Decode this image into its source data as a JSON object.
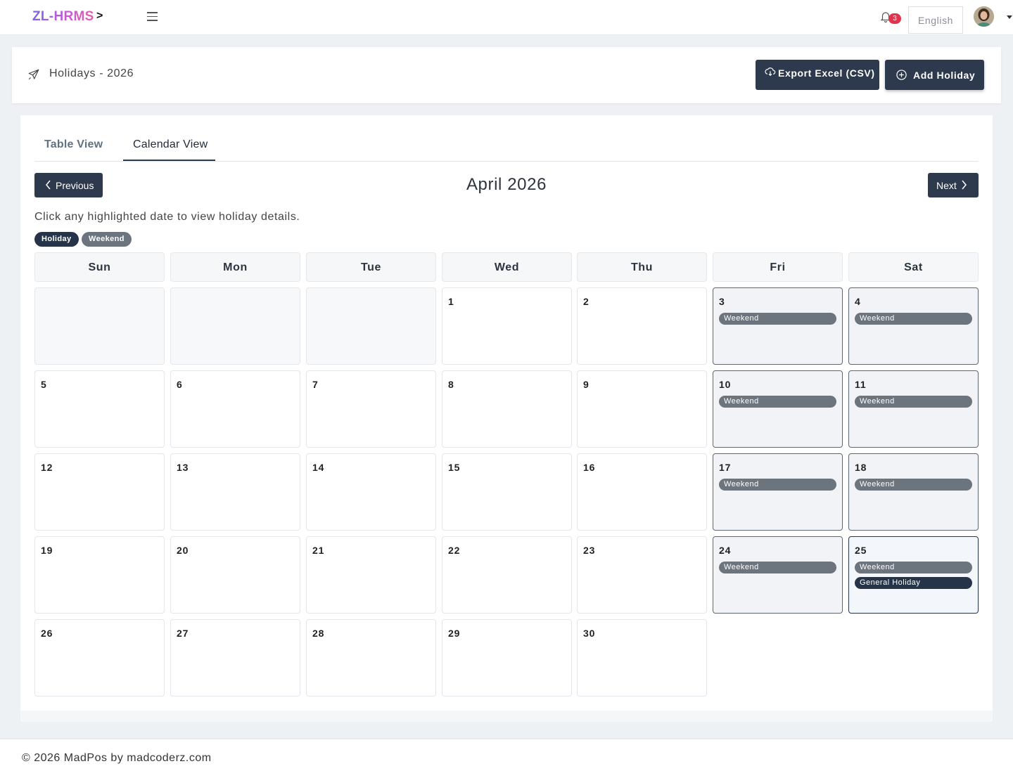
{
  "app": {
    "brand": "ZL-HRMS",
    "brand_caret": ">"
  },
  "topbar": {
    "notification_count": "3",
    "language": "English"
  },
  "header": {
    "title": "Holidays - 2026",
    "export_label": "Export Excel (CSV)",
    "add_label": "Add Holiday"
  },
  "tabs": [
    {
      "label": "Table View",
      "active": false
    },
    {
      "label": "Calendar View",
      "active": true
    }
  ],
  "calendar": {
    "month_title": "April 2026",
    "prev_label": "Previous",
    "next_label": "Next",
    "hint": "Click any highlighted date to view holiday details.",
    "legend": {
      "holiday": "Holiday",
      "weekend": "Weekend"
    },
    "weekdays": [
      "Sun",
      "Mon",
      "Tue",
      "Wed",
      "Thu",
      "Fri",
      "Sat"
    ],
    "first_weekday_index": 3,
    "days_in_month": 30,
    "events": {
      "3": [
        {
          "type": "weekend",
          "label": "Weekend"
        }
      ],
      "4": [
        {
          "type": "weekend",
          "label": "Weekend"
        }
      ],
      "10": [
        {
          "type": "weekend",
          "label": "Weekend"
        }
      ],
      "11": [
        {
          "type": "weekend",
          "label": "Weekend"
        }
      ],
      "17": [
        {
          "type": "weekend",
          "label": "Weekend"
        }
      ],
      "18": [
        {
          "type": "weekend",
          "label": "Weekend"
        }
      ],
      "24": [
        {
          "type": "weekend",
          "label": "Weekend"
        }
      ],
      "25": [
        {
          "type": "weekend",
          "label": "Weekend"
        },
        {
          "type": "holiday",
          "label": "General Holiday"
        }
      ]
    }
  },
  "footer": {
    "text": "© 2026 MadPos by madcoderz.com"
  },
  "colors": {
    "primary_dark": "#2d3a4d",
    "holiday": "#26344a",
    "weekend": "#6c747e",
    "badge": "#e0334c"
  }
}
